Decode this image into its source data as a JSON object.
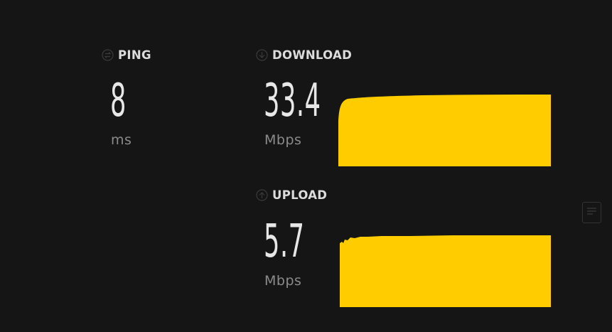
{
  "ping": {
    "label": "PING",
    "value": "8",
    "unit": "ms",
    "icon": "ping-icon"
  },
  "download": {
    "label": "DOWNLOAD",
    "value": "33.4",
    "unit": "Mbps",
    "icon": "download-arrow-icon"
  },
  "upload": {
    "label": "UPLOAD",
    "value": "5.7",
    "unit": "Mbps",
    "icon": "upload-arrow-icon"
  },
  "side_button": {
    "icon": "results-list-icon"
  },
  "colors": {
    "background": "#151515",
    "graph_fill": "#FFCC00",
    "label": "#dcdcdc",
    "value": "#e7e7e7",
    "unit": "#8b8b8b"
  }
}
